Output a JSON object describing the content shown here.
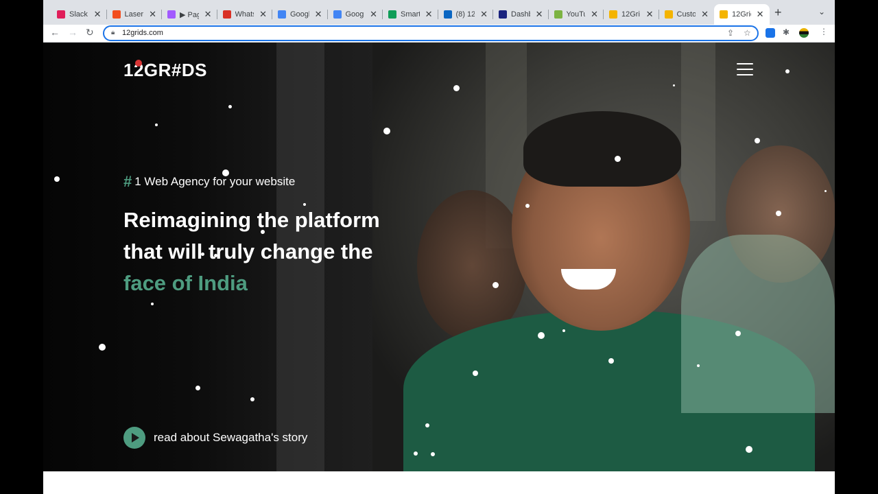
{
  "browser": {
    "tabs": [
      {
        "label": "Slack |",
        "favicon": "slack-icon",
        "color": "#e01e5a"
      },
      {
        "label": "Laser",
        "favicon": "figma-icon",
        "color": "#f24e1e"
      },
      {
        "label": "▶ Pag",
        "favicon": "figma-icon",
        "color": "#a259ff"
      },
      {
        "label": "Whats",
        "favicon": "alert-icon",
        "color": "#d93025"
      },
      {
        "label": "Googl",
        "favicon": "google-icon",
        "color": "#4285f4"
      },
      {
        "label": "Googl",
        "favicon": "google-icon",
        "color": "#4285f4"
      },
      {
        "label": "Smart",
        "favicon": "sheets-icon",
        "color": "#0f9d58"
      },
      {
        "label": "(8) 12",
        "favicon": "linkedin-icon",
        "color": "#0a66c2"
      },
      {
        "label": "Dashb",
        "favicon": "dashboard-icon",
        "color": "#1a237e"
      },
      {
        "label": "YouTu",
        "favicon": "youtube-icon",
        "color": "#7cb342"
      },
      {
        "label": "12Gri",
        "favicon": "12grids-icon",
        "color": "#f4b400"
      },
      {
        "label": "Custo",
        "favicon": "12grids-icon",
        "color": "#f4b400"
      },
      {
        "label": "12Grid",
        "favicon": "12grids-icon",
        "color": "#f4b400"
      }
    ],
    "active_tab": 12,
    "url": "12grids.com"
  },
  "site": {
    "logo": "12GR#DS",
    "tagline_hash": "#",
    "tagline": "1 Web Agency for your website",
    "headline_line1": "Reimagining the platform",
    "headline_line2": "that will truly change the",
    "headline_accent": "face of India",
    "story_link": "read about Sewagatha's story",
    "accent_color": "#4e9c80"
  }
}
